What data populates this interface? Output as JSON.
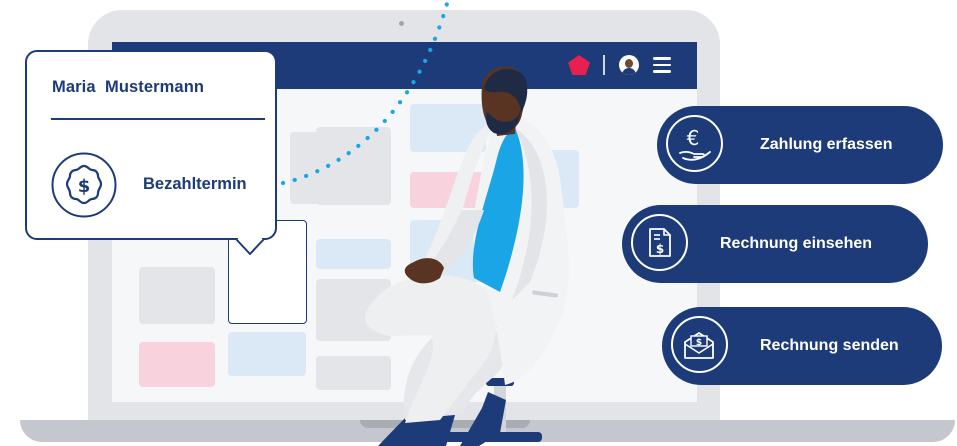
{
  "patient_card": {
    "name": "Maria  Mustermann",
    "appointment_label": "Bezahltermin",
    "icon": "dollar-badge-icon"
  },
  "actions": [
    {
      "label": "Zahlung erfassen",
      "icon": "euro-hand-icon"
    },
    {
      "label": "Rechnung einsehen",
      "icon": "dollar-document-icon"
    },
    {
      "label": "Rechnung senden",
      "icon": "dollar-envelope-icon"
    }
  ],
  "app_topbar": {
    "icons": [
      "ruby-gem-icon",
      "avatar-icon",
      "hamburger-menu-icon"
    ]
  },
  "colors": {
    "primary": "#1c3b78",
    "accent": "#e8204f",
    "highlight": "#1aa6e6",
    "tile_gray": "#e4e5e8",
    "tile_pink": "#f8d3dd",
    "tile_blue": "#dbe9f7"
  }
}
